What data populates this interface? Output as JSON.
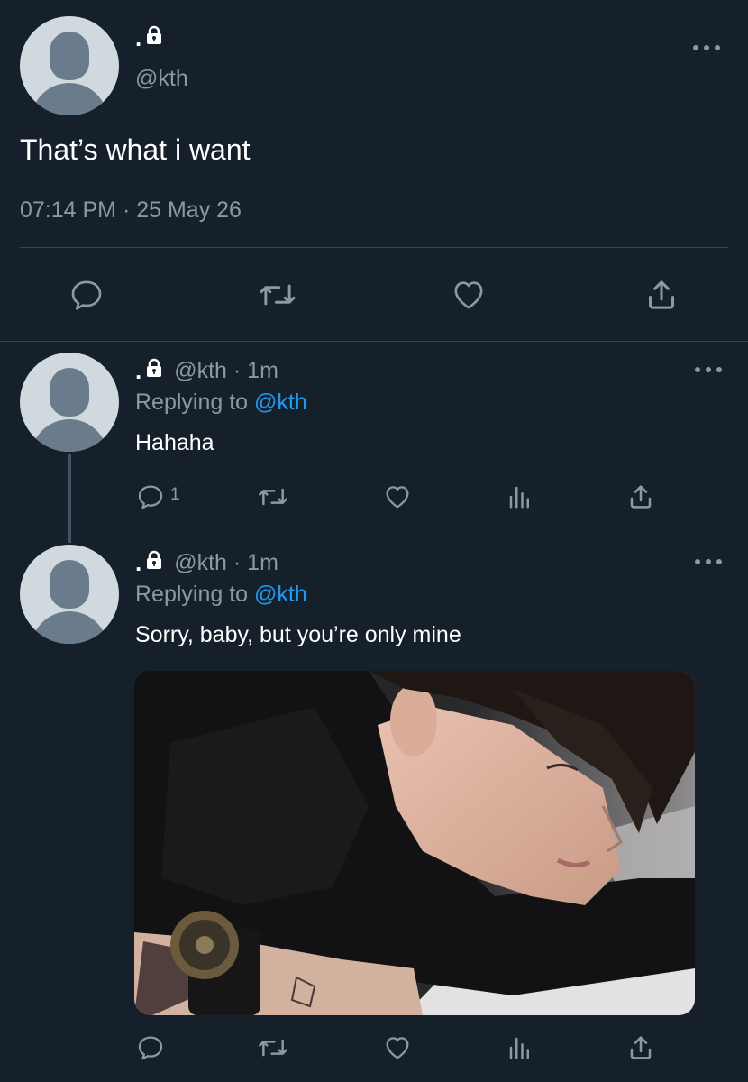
{
  "main_tweet": {
    "display_name": ".",
    "handle": "@kth",
    "text": "That’s what i want",
    "timestamp": "07:14 PM · 25 May 26"
  },
  "replies": [
    {
      "display_name": ".",
      "handle_time": "@kth · 1m",
      "replying_prefix": "Replying to",
      "replying_handle": "@kth",
      "text": "Hahaha",
      "reply_count": "1"
    },
    {
      "display_name": ".",
      "handle_time": "@kth · 1m",
      "replying_prefix": "Replying to",
      "replying_handle": "@kth",
      "text": "Sorry, baby, but you’re only mine",
      "reply_count": ""
    }
  ],
  "icons": {
    "reply": "reply-icon",
    "retweet": "retweet-icon",
    "like": "heart-icon",
    "analytics": "analytics-icon",
    "share": "share-icon",
    "lock": "lock-icon",
    "more": "more-icon"
  },
  "colors": {
    "background": "#15202b",
    "text": "#ffffff",
    "muted": "#8b98a5",
    "link": "#1d9bf0",
    "divider": "#38444d"
  }
}
